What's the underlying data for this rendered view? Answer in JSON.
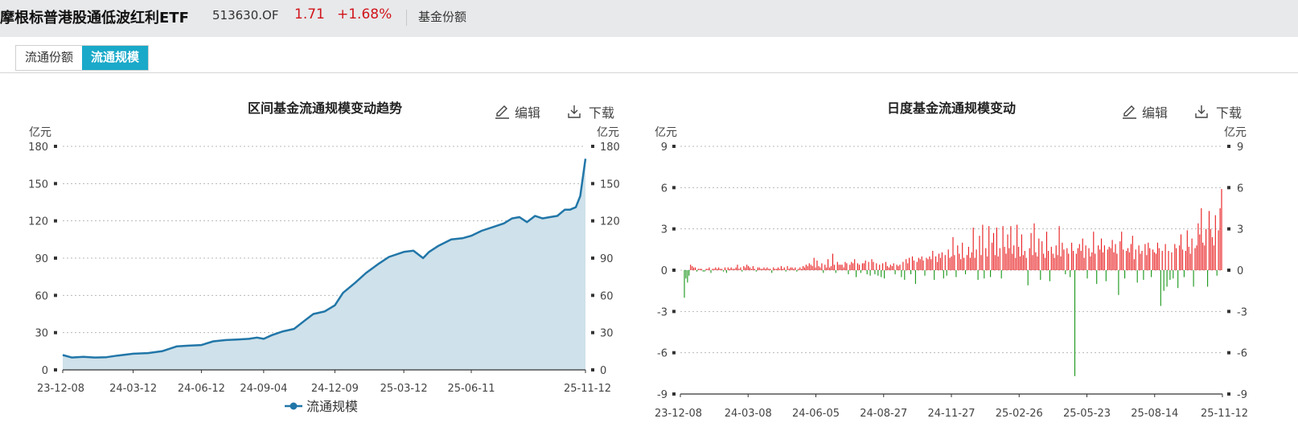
{
  "header": {
    "fund_name": "摩根标普港股通低波红利ETF",
    "code": "513630.OF",
    "price": "1.71",
    "change_pct": "+1.68%",
    "share_label": "基金份额"
  },
  "tabs": [
    {
      "label": "流通份额",
      "active": false
    },
    {
      "label": "流通规模",
      "active": true
    }
  ],
  "colors": {
    "accent_tab": "#1aa9c9",
    "line": "#2176a8",
    "area": "#cfe1ea",
    "up": "#e8191b",
    "down": "#159515",
    "price_up": "#d0141b"
  },
  "toolbar": {
    "edit_label": "编辑",
    "download_label": "下载",
    "edit_icon": "pencil-icon",
    "download_icon": "download-icon"
  },
  "chart_data": [
    {
      "type": "area",
      "title": "区间基金流通规模变动趋势",
      "ylabel_left": "亿元",
      "ylabel_right": "亿元",
      "ylim": [
        0,
        180
      ],
      "yticks": [
        0,
        30,
        60,
        90,
        120,
        150,
        180
      ],
      "xticks": [
        "23-12-08",
        "24-03-12",
        "24-06-12",
        "24-09-04",
        "24-12-09",
        "25-03-12",
        "25-06-11",
        "25-11-12"
      ],
      "legend": "bottom",
      "grid": true,
      "series": [
        {
          "name": "流通规模",
          "x": [
            "23-12-08",
            "23-12-20",
            "24-01-05",
            "24-01-20",
            "24-02-05",
            "24-02-20",
            "24-03-12",
            "24-04-01",
            "24-04-20",
            "24-05-10",
            "24-05-25",
            "24-06-12",
            "24-06-28",
            "24-07-15",
            "24-07-30",
            "24-08-15",
            "24-08-26",
            "24-09-04",
            "24-09-15",
            "24-09-30",
            "24-10-15",
            "24-10-30",
            "24-11-10",
            "24-11-25",
            "24-12-09",
            "24-12-20",
            "25-01-05",
            "25-01-20",
            "25-02-05",
            "25-02-20",
            "25-03-12",
            "25-03-25",
            "25-04-07",
            "25-04-15",
            "25-04-28",
            "25-05-15",
            "25-05-30",
            "25-06-11",
            "25-06-25",
            "25-07-10",
            "25-07-25",
            "25-08-05",
            "25-08-15",
            "25-08-25",
            "25-09-05",
            "25-09-15",
            "25-09-25",
            "25-10-05",
            "25-10-15",
            "25-10-22",
            "25-10-30",
            "25-11-05",
            "25-11-12"
          ],
          "values": [
            12,
            10,
            10.5,
            10,
            10.2,
            11.5,
            13,
            13.5,
            15,
            19,
            19.5,
            20,
            23,
            24,
            24.5,
            25,
            26,
            25,
            28,
            31,
            33,
            40,
            45,
            47,
            52,
            62,
            70,
            78,
            85,
            91,
            95,
            96,
            90,
            95,
            100,
            105,
            106,
            108,
            112,
            115,
            118,
            122,
            123,
            119,
            124,
            122,
            123,
            124,
            129,
            129,
            131,
            140,
            170
          ]
        }
      ]
    },
    {
      "type": "bar",
      "title": "日度基金流通规模变动",
      "ylabel_left": "亿元",
      "ylabel_right": "亿元",
      "ylim": [
        -9,
        9
      ],
      "yticks": [
        -9,
        -6,
        -3,
        0,
        3,
        6,
        9
      ],
      "xticks": [
        "23-12-08",
        "24-03-08",
        "24-06-05",
        "24-08-27",
        "24-11-27",
        "25-02-26",
        "25-05-23",
        "25-08-14",
        "25-11-12"
      ],
      "grid": true,
      "series": [
        {
          "name": "",
          "period_from": "23-12-08",
          "period_to": "25-11-12",
          "values": [
            -2,
            -0.6,
            -0.9,
            -0.4,
            0.4,
            0.3,
            0.2,
            0.2,
            -0.1,
            0.1,
            0.1,
            0.1,
            -0.1,
            -0.1,
            0.1,
            0.1,
            0.2,
            -0.2,
            0.1,
            0.1,
            0.2,
            0.1,
            0.2,
            0.1,
            0.1,
            -0.1,
            0.2,
            -0.2,
            0.2,
            0.1,
            0.2,
            0.1,
            0.1,
            0.2,
            0.4,
            0.1,
            0.2,
            -0.1,
            0.3,
            0.2,
            0.4,
            0.3,
            0.2,
            0.1,
            0.3,
            0.1,
            -0.1,
            0.2,
            0.2,
            0.1,
            0.1,
            0.2,
            0.1,
            0.2,
            0.1,
            0.1,
            -0.2,
            0.2,
            0.1,
            0.1,
            0.2,
            0.1,
            0.3,
            0.1,
            0.2,
            -0.1,
            0.3,
            0.1,
            0.2,
            0.2,
            0.1,
            0.2,
            -0.1,
            0.1,
            0.2,
            0.1,
            0.3,
            0.2,
            0.4,
            0.3,
            0.5,
            0.4,
            0.3,
            0.9,
            0.2,
            0.7,
            0.3,
            0.2,
            0.5,
            -0.2,
            0.4,
            0.2,
            0.8,
            0.2,
            0.3,
            1.2,
            0.4,
            -0.2,
            0.6,
            0.4,
            0.4,
            0.4,
            0.2,
            0.6,
            0.5,
            -0.3,
            0.4,
            0.6,
            0.5,
            0.8,
            -0.5,
            0.5,
            0.4,
            -0.2,
            0.5,
            0.5,
            0.7,
            -0.3,
            0.6,
            -0.4,
            0.8,
            0.6,
            -0.3,
            0.5,
            -0.4,
            0.4,
            -0.5,
            0.5,
            -0.6,
            0.6,
            0.3,
            0.2,
            0.4,
            0.3,
            0.5,
            -0.3,
            0.4,
            0.3,
            0.4,
            -0.5,
            0.6,
            -0.7,
            0.8,
            0.5,
            0.9,
            -0.3,
            1.0,
            0.7,
            -1.0,
            0.6,
            0.9,
            0.8,
            1.0,
            0.7,
            -0.4,
            0.9,
            0.8,
            1.0,
            0.8,
            1.4,
            -0.7,
            1.0,
            0.6,
            1.2,
            0.9,
            1.3,
            -0.6,
            1.1,
            -0.4,
            1.5,
            0.9,
            1.0,
            2.4,
            1.1,
            -0.5,
            1.8,
            1.2,
            0.8,
            2.0,
            0.9,
            -0.3,
            1.1,
            1.7,
            0.9,
            1.3,
            3.1,
            0.9,
            1.5,
            -0.7,
            2.5,
            1.1,
            3.3,
            -0.6,
            1.6,
            1.0,
            3.2,
            -0.5,
            2.0,
            2.7,
            1.1,
            3.1,
            1.0,
            1.6,
            -0.6,
            3.2,
            1.7,
            1.2,
            2.6,
            1.6,
            3.2,
            1.2,
            1.8,
            0.9,
            3.3,
            1.7,
            1.0,
            2.6,
            1.1,
            1.4,
            0.9,
            -1.1,
            1.6,
            2.7,
            1.1,
            3.4,
            1.3,
            1.0,
            2.3,
            -0.7,
            2.1,
            1.2,
            0.9,
            2.8,
            1.4,
            -0.8,
            1.7,
            1.2,
            0.9,
            1.8,
            1.1,
            3.2,
            1.0,
            2.0,
            1.5,
            -0.3,
            1.6,
            1.2,
            -0.5,
            2.0,
            1.4,
            -7.7,
            1.2,
            1.6,
            1.9,
            1.4,
            2.3,
            0.9,
            1.8,
            -0.6,
            1.6,
            1.0,
            1.3,
            2.8,
            1.2,
            -1.0,
            1.8,
            1.5,
            2.3,
            1.3,
            1.8,
            -0.8,
            1.5,
            1.7,
            1.6,
            2.2,
            1.3,
            1.9,
            1.2,
            -1.8,
            2.1,
            2.8,
            1.5,
            -0.6,
            1.4,
            1.6,
            1.3,
            1.9,
            2.5,
            0.8,
            1.5,
            -0.9,
            1.8,
            1.2,
            1.4,
            -0.7,
            1.9,
            1.1,
            2.0,
            1.6,
            -0.5,
            1.5,
            1.3,
            1.2,
            2.0,
            1.6,
            -2.6,
            1.4,
            -1.5,
            1.9,
            -1.2,
            1.4,
            -0.7,
            1.3,
            -0.6,
            1.9,
            1.6,
            -1.3,
            1.8,
            2.6,
            1.5,
            -0.5,
            1.4,
            2.9,
            1.7,
            1.2,
            2.3,
            -1.2,
            1.6,
            1.8,
            3.4,
            2.6,
            4.5,
            2.0,
            1.8,
            3.0,
            -1.2,
            4.3,
            3.0,
            2.4,
            1.8,
            4.0,
            -0.4,
            2.9,
            4.5,
            5.9
          ]
        }
      ]
    }
  ]
}
